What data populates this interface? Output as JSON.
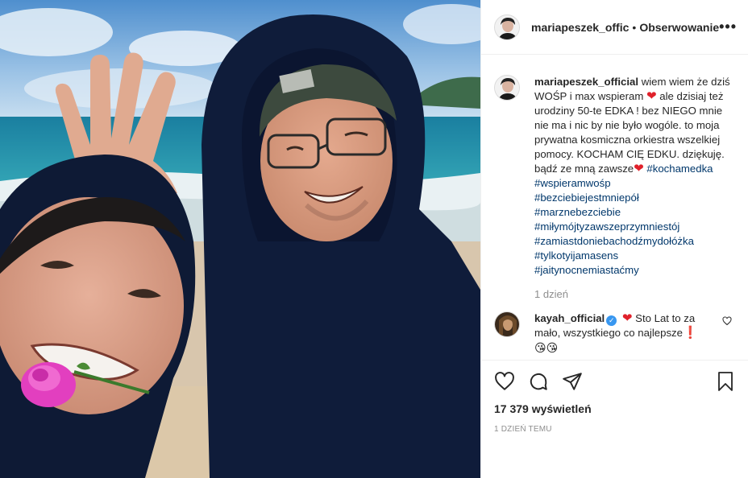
{
  "post": {
    "author": "mariapeszek_offic",
    "separator": "•",
    "follow_label": "Obserwowanie",
    "more_label": "•••"
  },
  "caption": {
    "username": "mariapeszek_official",
    "text_part1": "wiem wiem że dziś WOŚP i max wspieram",
    "text_part2": "ale dzisiaj też urodziny 50-te EDKA ! bez NIEGO mnie nie ma i nic by nie było wogóle. to moja prywatna kosmiczna orkiestra wszelkiej pomocy. KOCHAM CIĘ EDKU. dziękuję. bądź ze mną zawsze",
    "heart": "❤",
    "hashtags": [
      "#kochamedka",
      "#wspieramwośp",
      "#bezciebiejestmniepół",
      "#marznebezciebie",
      "#miłymójtyzawszeprzymniestój",
      "#zamiastdoniebachodźmydołóżka",
      "#tylkotyijamasens",
      "#jaitynocnemiastaćmy"
    ],
    "time": "1 dzień"
  },
  "comment": {
    "username": "kayah_official",
    "verified_mark": "✓",
    "heart": "❤",
    "text": "Sto Lat to za mało, wszystkiego co najlepsze",
    "exclamation": "❗",
    "emoji": "😘😘"
  },
  "stats": {
    "views": "17 379 wyświetleń",
    "posted": "1 DZIEŃ TEMU"
  },
  "colors": {
    "link": "#00376b",
    "heart": "#e0212b",
    "muted": "#8e8e8e",
    "verified": "#3897f0",
    "border": "#efefef"
  },
  "icons": [
    "heart-outline-icon",
    "comment-bubble-icon",
    "share-paper-plane-icon",
    "bookmark-icon",
    "ellipsis-icon",
    "verified-badge-icon"
  ]
}
